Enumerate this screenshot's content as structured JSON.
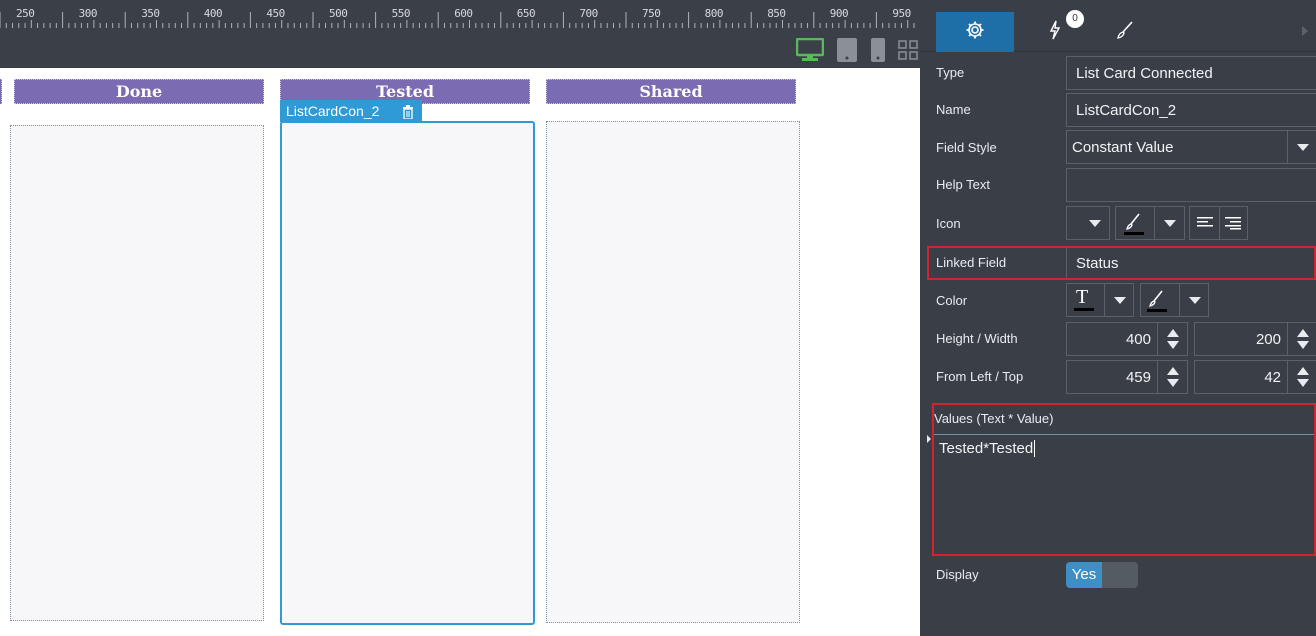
{
  "ruler": {
    "labels": [
      "250",
      "300",
      "350",
      "400",
      "450",
      "500",
      "550",
      "600",
      "650",
      "700",
      "750",
      "800",
      "850",
      "900",
      "950"
    ]
  },
  "device_bar": {
    "icons": [
      "desktop-icon",
      "tablet-icon",
      "phone-icon",
      "grid-icon"
    ],
    "active_color": "#5cb85c"
  },
  "canvas": {
    "columns": [
      {
        "header": "Done"
      },
      {
        "header": "Tested"
      },
      {
        "header": "Shared"
      }
    ],
    "selected_label": "ListCardCon_2",
    "header_color": "#7b6bb2",
    "selection_color": "#2f9ad6"
  },
  "panel": {
    "tabs": {
      "settings_icon": "gear-icon",
      "events_icon": "lightning-icon",
      "events_badge": "0",
      "style_icon": "brush-icon"
    },
    "type": {
      "label": "Type",
      "value": "List Card Connected"
    },
    "name": {
      "label": "Name",
      "value": "ListCardCon_2"
    },
    "field_style": {
      "label": "Field Style",
      "value": "Constant Value"
    },
    "help_text": {
      "label": "Help Text",
      "value": ""
    },
    "icon": {
      "label": "Icon"
    },
    "linked_field": {
      "label": "Linked Field",
      "value": "Status"
    },
    "color": {
      "label": "Color"
    },
    "height_width": {
      "label": "Height / Width",
      "height": "400",
      "width": "200"
    },
    "from_left_top": {
      "label": "From Left / Top",
      "left": "459",
      "top": "42"
    },
    "values": {
      "label": "Values (Text * Value)",
      "value": "Tested*Tested"
    },
    "display": {
      "label": "Display",
      "value": "Yes"
    },
    "highlight_color": "#d0252c",
    "accent_color": "#1e6fa8"
  }
}
